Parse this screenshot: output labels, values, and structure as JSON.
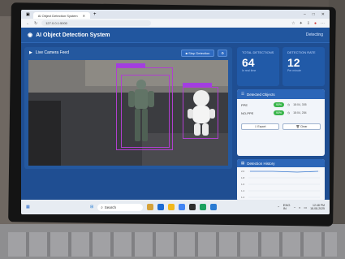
{
  "browser": {
    "tab_title": "AI Object Detection System",
    "url": "127.0.0.1:5000",
    "window_controls": [
      "–",
      "□",
      "✕"
    ]
  },
  "app": {
    "title": "AI Object Detection System",
    "status": "Detecting"
  },
  "camera": {
    "title": "Live Camera Feed",
    "stop_button": "Stop Detection"
  },
  "stats": {
    "total_label": "TOTAL DETECTIONS",
    "total_value": "64",
    "total_sub": "In real time",
    "rate_label": "DETECTION RATE",
    "rate_value": "12",
    "rate_sub": "Per minute"
  },
  "detected": {
    "title": "Detected Objects",
    "rows": [
      {
        "name": "PPE",
        "conf": "90%",
        "time": "18:04, 305"
      },
      {
        "name": "NO-PPE",
        "conf": "90%",
        "time": "18:04, 284"
      }
    ],
    "export_label": "Export",
    "clear_label": "Clear"
  },
  "history": {
    "title": "Detection History",
    "y_ticks": [
      "2.0",
      "1.8",
      "1.6",
      "1.4",
      "1.2"
    ]
  },
  "taskbar": {
    "search_placeholder": "Search",
    "tray_lang": "ENG",
    "tray_region": "IN",
    "time": "12:48 PM",
    "date": "18-08-2025"
  },
  "colors": {
    "accent": "#1f4e92",
    "bbox": "#b03fd0",
    "conf_pill": "#39b54a"
  }
}
